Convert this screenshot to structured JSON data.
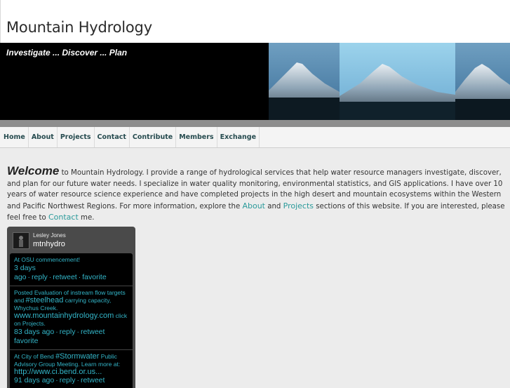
{
  "site": {
    "title": "Mountain Hydrology",
    "tagline": "Investigate ... Discover ... Plan"
  },
  "nav": {
    "items": [
      "Home",
      "About",
      "Projects",
      "Contact",
      "Contribute",
      "Members",
      "Exchange"
    ]
  },
  "intro": {
    "welcome": "Welcome",
    "text_1": " to Mountain Hydrology. I provide a range of hydrological services that help water resource managers investigate, discover, and plan for our future water needs.  I specialize in water quality monitoring, environmental statistics, and GIS applications.  I have over 10 years of water resource science experience and have completed projects in the high desert and mountain ecosystems within the Western and Pacific Northwest Regions. For more information, explore the ",
    "link_about": "About",
    "text_2": " and ",
    "link_projects": "Projects",
    "text_3": " sections of this website.  If you are interested, please feel free to ",
    "link_contact": "Contact",
    "text_4": " me."
  },
  "twitter": {
    "name": "Lesley Jones",
    "handle": "mtnhydro",
    "tweets": [
      {
        "text_a": "At OSU commencement!",
        "tag": "",
        "text_b": "",
        "url": "",
        "text_c": "",
        "time": "3 days ago",
        "reply": "reply",
        "retweet": "retweet",
        "favorite": "favorite"
      },
      {
        "text_a": "Posted Evaluation of instream flow targets and ",
        "tag": "#steelhead",
        "text_b": " carrying capacity, Whychus Creek. ",
        "url": "www.mountainhydrology.com",
        "text_c": " click on Projects.",
        "time": "83 days ago",
        "reply": "reply",
        "retweet": "retweet",
        "favorite": "favorite"
      },
      {
        "text_a": "At City of Bend ",
        "tag": "#Stormwater",
        "text_b": " Public Advisory Group Meeting. Learn more at: ",
        "url": "http://www.ci.bend.or.us...",
        "text_c": "",
        "time": "91 days ago",
        "reply": "reply",
        "retweet": "retweet",
        "favorite": ""
      }
    ]
  },
  "colors": {
    "accent_link": "#2a9a9a",
    "nav_text": "#264b4f",
    "tweet_text": "#33b5c8"
  }
}
